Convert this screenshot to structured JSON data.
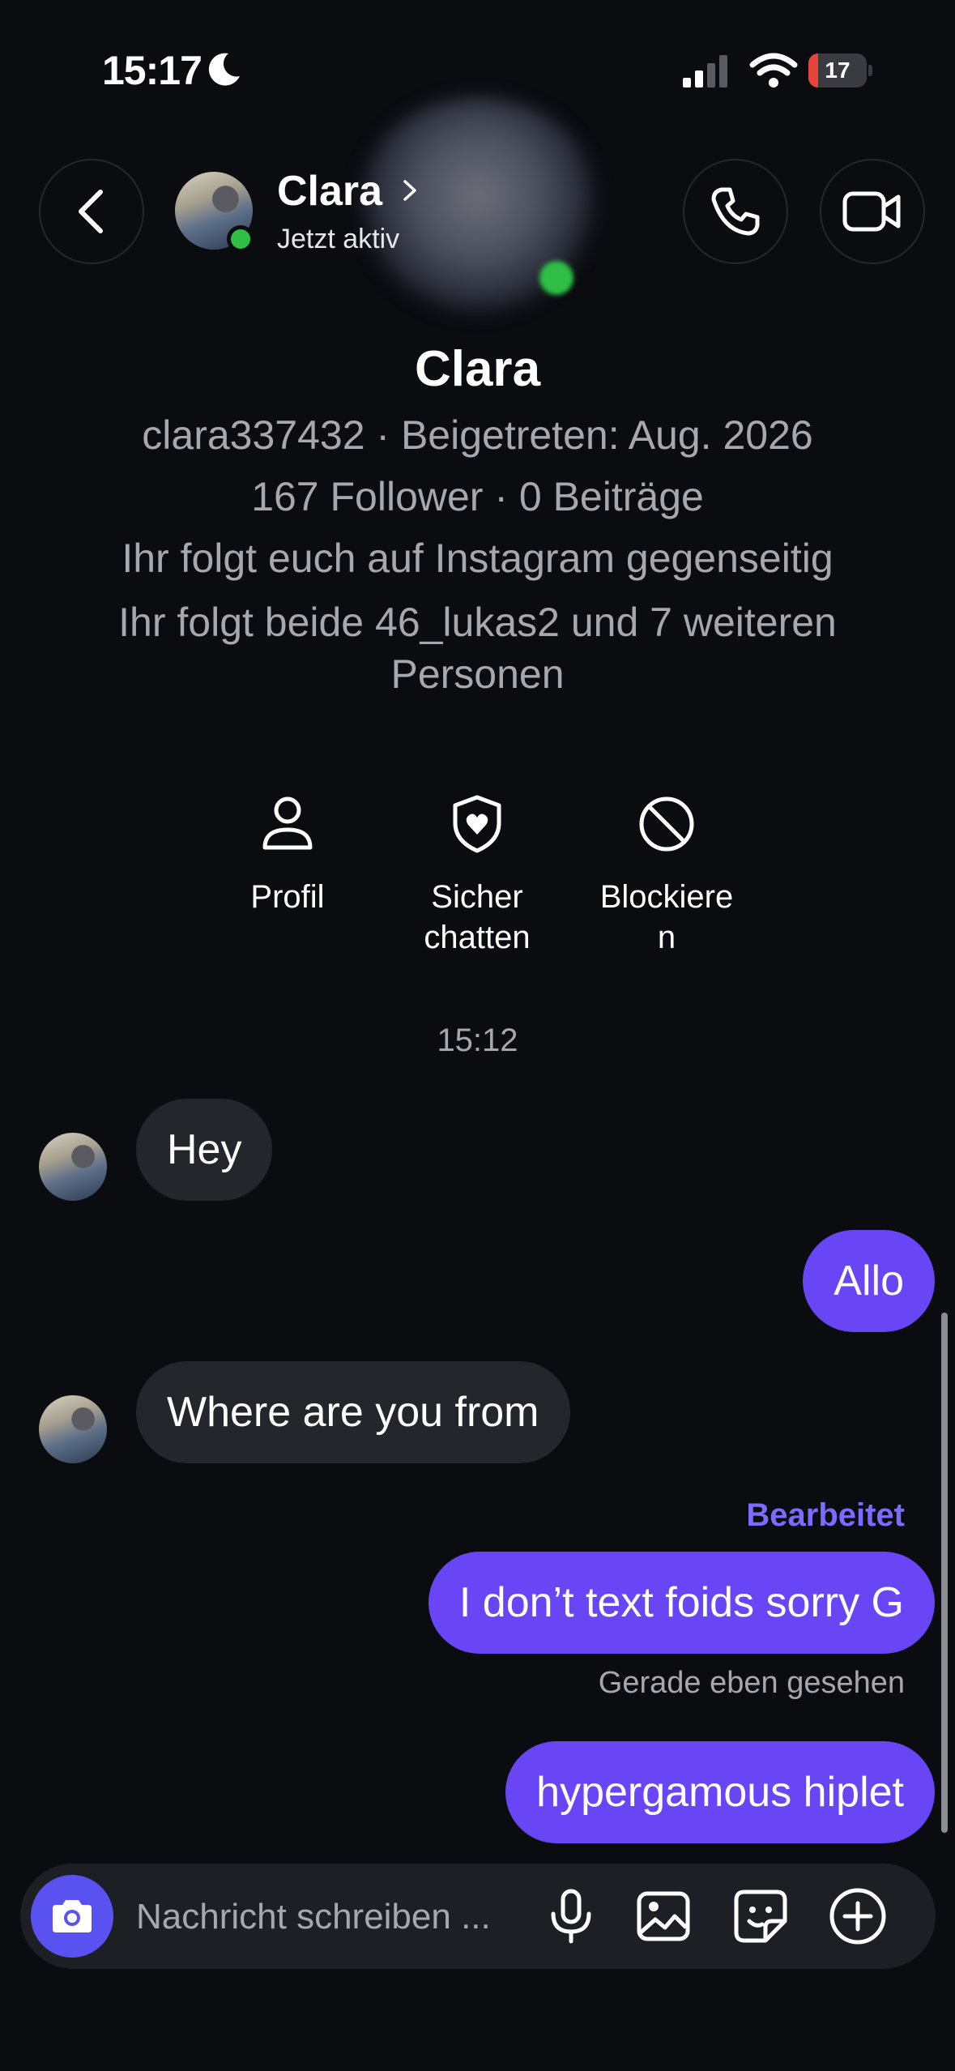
{
  "status_bar": {
    "time": "15:17",
    "battery": "17",
    "battery_level": 0.17
  },
  "header": {
    "name": "Clara",
    "status": "Jetzt aktiv"
  },
  "profile": {
    "name": "Clara",
    "meta": "clara337432 · Beigetreten: Aug. 2026",
    "stats": "167 Follower · 0 Beiträge",
    "mutual": "Ihr folgt euch auf Instagram gegenseitig",
    "mutual_friends": "Ihr folgt beide 46_lukas2 und 7 weiteren Personen"
  },
  "actions": [
    {
      "label": "Profil",
      "icon": "person-icon"
    },
    {
      "label": "Sicher chatten",
      "icon": "shield-heart-icon"
    },
    {
      "label": "Blockiere n",
      "icon": "block-icon"
    }
  ],
  "chat": {
    "time": "15:12",
    "messages": [
      {
        "from": "them",
        "text": "Hey"
      },
      {
        "from": "me",
        "text": "Allo"
      },
      {
        "from": "them",
        "text": "Where are you from"
      },
      {
        "from": "me",
        "text": "I don’t text foids sorry G",
        "edited": "Bearbeitet"
      },
      {
        "from": "me",
        "text": "hypergamous hiplet"
      }
    ],
    "seen": "Gerade eben gesehen"
  },
  "composer": {
    "placeholder": "Nachricht schreiben ..."
  },
  "colors": {
    "accent": "#6845f5",
    "online": "#2fbf47",
    "background": "#0b0c10",
    "incoming_bubble": "#25262b"
  }
}
